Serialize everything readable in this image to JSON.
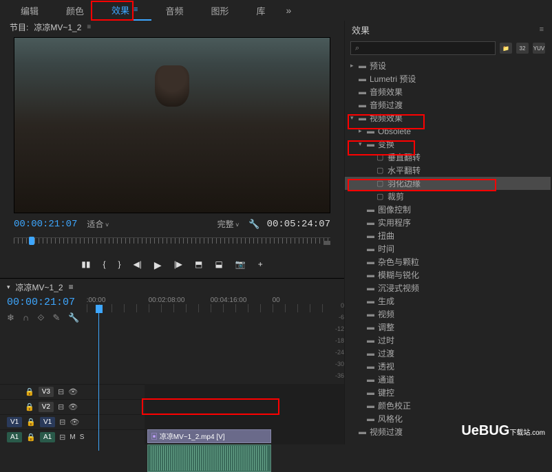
{
  "topbar": {
    "items": [
      "编辑",
      "颜色",
      "效果",
      "音频",
      "图形",
      "库"
    ],
    "active_index": 2,
    "overflow": "»"
  },
  "project": {
    "tab_prefix": "节目:",
    "tab_name": "凉凉MV~1_2",
    "current_time": "00:00:21:07",
    "fit_label": "适合",
    "quality_label": "完整",
    "duration": "00:05:24:07"
  },
  "controls": {
    "markers": "▮▮",
    "in_point": "◀|",
    "out_point": "|▶",
    "step_back": "◀|",
    "play": "▶",
    "step_fwd": "|▶",
    "loop": "↻",
    "export": "↗",
    "camera": "📷",
    "plus": "+"
  },
  "timeline": {
    "tab_name": "凉凉MV~1_2",
    "current_time": "00:00:21:07",
    "ruler": [
      ":00:00",
      "00:02:08:00",
      "00:04:16:00",
      "00"
    ],
    "tools": [
      "❄",
      "∩",
      "⟐",
      "✎",
      "↔",
      "◀",
      "⊡",
      "⌄"
    ],
    "tracks": [
      {
        "type": "video",
        "label": "V3",
        "muted": true
      },
      {
        "type": "video",
        "label": "V2",
        "muted": true
      },
      {
        "type": "video",
        "label": "V1",
        "muted": false,
        "source_label": "V1"
      },
      {
        "type": "audio",
        "label": "A1",
        "muted": false,
        "source_label": "A1"
      }
    ],
    "clip_name": "凉凉MV~1_2.mp4 [V]",
    "db_scale": [
      "0",
      "-6",
      "-12",
      "-18",
      "-24",
      "-30",
      "-36"
    ]
  },
  "effects": {
    "panel_title": "效果",
    "search_placeholder": "",
    "search_icon": "⌕",
    "badges": [
      "📁",
      "32",
      "YUV"
    ],
    "tree": [
      {
        "depth": 0,
        "arrow": ">",
        "icon": "folder",
        "label": "预设"
      },
      {
        "depth": 0,
        "arrow": "",
        "icon": "folder",
        "label": "Lumetri 预设"
      },
      {
        "depth": 0,
        "arrow": "",
        "icon": "folder",
        "label": "音频效果"
      },
      {
        "depth": 0,
        "arrow": "",
        "icon": "folder",
        "label": "音频过渡"
      },
      {
        "depth": 0,
        "arrow": "v",
        "icon": "folder",
        "label": "视频效果",
        "highlight": "red"
      },
      {
        "depth": 1,
        "arrow": ">",
        "icon": "folder",
        "label": "Obsolete"
      },
      {
        "depth": 1,
        "arrow": "v",
        "icon": "folder",
        "label": "变换",
        "highlight": "red"
      },
      {
        "depth": 2,
        "arrow": "",
        "icon": "preset",
        "label": "垂直翻转"
      },
      {
        "depth": 2,
        "arrow": "",
        "icon": "preset",
        "label": "水平翻转"
      },
      {
        "depth": 2,
        "arrow": "",
        "icon": "preset",
        "label": "羽化边缘",
        "highlight": "red",
        "selected": true
      },
      {
        "depth": 2,
        "arrow": "",
        "icon": "preset",
        "label": "裁剪"
      },
      {
        "depth": 1,
        "arrow": "",
        "icon": "folder",
        "label": "图像控制"
      },
      {
        "depth": 1,
        "arrow": "",
        "icon": "folder",
        "label": "实用程序"
      },
      {
        "depth": 1,
        "arrow": "",
        "icon": "folder",
        "label": "扭曲"
      },
      {
        "depth": 1,
        "arrow": "",
        "icon": "folder",
        "label": "时间"
      },
      {
        "depth": 1,
        "arrow": "",
        "icon": "folder",
        "label": "杂色与颗粒"
      },
      {
        "depth": 1,
        "arrow": "",
        "icon": "folder",
        "label": "模糊与锐化"
      },
      {
        "depth": 1,
        "arrow": "",
        "icon": "folder",
        "label": "沉浸式视频"
      },
      {
        "depth": 1,
        "arrow": "",
        "icon": "folder",
        "label": "生成"
      },
      {
        "depth": 1,
        "arrow": "",
        "icon": "folder",
        "label": "视频"
      },
      {
        "depth": 1,
        "arrow": "",
        "icon": "folder",
        "label": "调整"
      },
      {
        "depth": 1,
        "arrow": "",
        "icon": "folder",
        "label": "过时"
      },
      {
        "depth": 1,
        "arrow": "",
        "icon": "folder",
        "label": "过渡"
      },
      {
        "depth": 1,
        "arrow": "",
        "icon": "folder",
        "label": "透视"
      },
      {
        "depth": 1,
        "arrow": "",
        "icon": "folder",
        "label": "通道"
      },
      {
        "depth": 1,
        "arrow": "",
        "icon": "folder",
        "label": "键控"
      },
      {
        "depth": 1,
        "arrow": "",
        "icon": "folder",
        "label": "颜色校正"
      },
      {
        "depth": 1,
        "arrow": "",
        "icon": "folder",
        "label": "风格化"
      },
      {
        "depth": 0,
        "arrow": "",
        "icon": "folder",
        "label": "视频过渡"
      }
    ]
  },
  "watermark": {
    "main": "UeBUG",
    "sub": "下载站",
    "suffix": ".com"
  }
}
